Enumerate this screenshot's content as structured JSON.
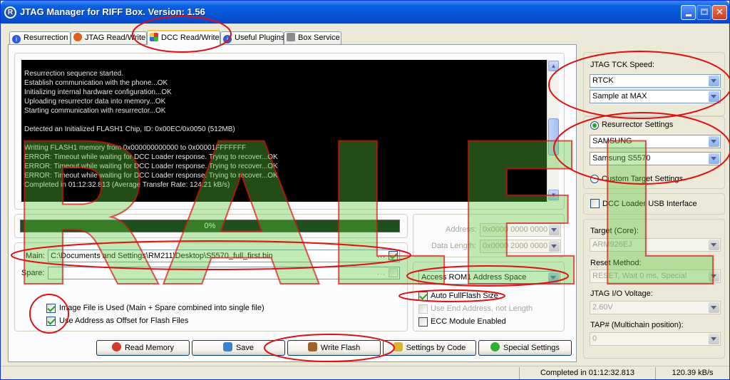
{
  "window": {
    "title": "JTAG Manager for RIFF Box. Version: 1.56"
  },
  "tabs": [
    {
      "label": "Resurrection"
    },
    {
      "label": "JTAG Read/Write"
    },
    {
      "label": "DCC Read/Write"
    },
    {
      "label": "Useful Plugins"
    },
    {
      "label": "Box Service"
    }
  ],
  "console": {
    "lines": [
      "Resurrection sequence started.",
      "Establish communication with the phone...OK",
      "Initializing internal hardware configuration...OK",
      "Uploading resurrector data into memory...OK",
      "Starting communication with resurrector...OK",
      "",
      "Detected an Initialized FLASH1 Chip, ID: 0x00EC/0x0050 (512MB)",
      "",
      "Writting FLASH1 memory from 0x000000000000 to 0x00001FFFFFFF",
      "ERROR: Timeout while waiting for DCC Loader response. Trying to recover...OK",
      "ERROR: Timeout while waiting for DCC Loader response. Trying to recover...OK",
      "ERROR: Timeout while waiting for DCC Loader response. Trying to recover...OK",
      "Completed in 01:12:32.813 (Average Transfer Rate: 124.21 kB/s)"
    ]
  },
  "progress": {
    "text": "0%",
    "value": 0
  },
  "address": {
    "label": "Address:",
    "value": "0x0000 0000 0000"
  },
  "data_length": {
    "label": "Data Length:",
    "value": "0x0000 2000 0000"
  },
  "files": {
    "main_label": "Main:",
    "main_value": "C:\\Documents and Settings\\RM211\\Desktop\\S5570_full_first.bin",
    "spare_label": "Spare:",
    "spare_value": "",
    "browse": "..."
  },
  "options": {
    "image_file_used": "Image File is Used (Main + Spare combined into single file)",
    "use_address_offset": "Use Address as Offset for Flash Files"
  },
  "address_space": {
    "selected": "Access ROM1 Address Space"
  },
  "flash_options": {
    "auto_fullflash": "Auto FullFlash Size",
    "use_end_address": "Use End Address, not Length",
    "ecc_module": "ECC Module Enabled"
  },
  "buttons": {
    "read_memory": "Read Memory",
    "save": "Save",
    "write_flash": "Write Flash",
    "settings_by_code": "Settings by Code",
    "special_settings": "Special Settings"
  },
  "right_panel": {
    "tck_speed_label": "JTAG TCK Speed:",
    "tck_speed": "RTCK",
    "sample": "Sample at MAX",
    "resurrector_settings": "Resurrector Settings",
    "manufacturer": "SAMSUNG",
    "model": "Samsung S5570",
    "custom_target": "Custom Target Settings",
    "dcc_loader_usb": "DCC Loader USB Interface",
    "target_core_label": "Target (Core):",
    "target_core": "ARM926EJ",
    "reset_method_label": "Reset Method:",
    "reset_method": "RESET, Wait 0 ms, Special",
    "io_voltage_label": "JTAG I/O Voltage:",
    "io_voltage": "2.60V",
    "tap_label": "TAP# (Multichain position):",
    "tap": "0"
  },
  "status": {
    "completed": "Completed in 01:12:32.813",
    "rate": "120.39 kB/s"
  },
  "watermark": {
    "text": "RALEL"
  },
  "colors": {
    "annotation": "#e01010",
    "watermark_fill": "#5fc83a",
    "console_bg": "#000000",
    "progress_bg": "#1e4f1e"
  }
}
